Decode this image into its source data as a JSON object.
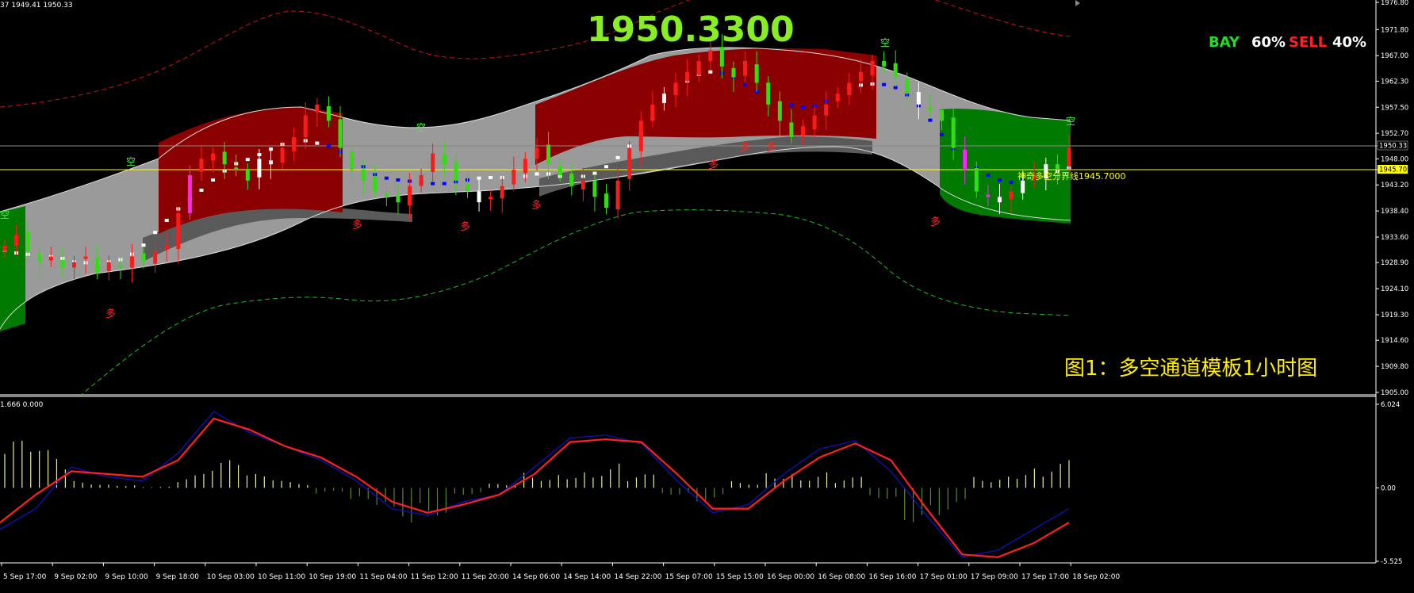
{
  "window": {
    "header_text": "37 1949.41 1950.33",
    "macd_header": "1.666 0.000"
  },
  "current_price_label": "1950.3300",
  "sentiment": {
    "buy_label": "BAY",
    "buy_pct": "60%",
    "sell_label": "SELL",
    "sell_pct": "40%"
  },
  "boundary_label": "神奇多空分界线1945.7000",
  "figure_caption": "图1：多空通道模板1小时图",
  "main_axis": {
    "ticks": [
      "1976.80",
      "1971.80",
      "1967.00",
      "1962.30",
      "1957.50",
      "1952.70",
      "1948.00",
      "1943.20",
      "1938.40",
      "1933.60",
      "1928.90",
      "1924.10",
      "1919.30",
      "1914.60",
      "1909.80",
      "1905.00"
    ],
    "current_marker": "1950.33",
    "boundary_marker": "1945.70"
  },
  "macd_axis": {
    "ticks": [
      "6.024",
      "0.00",
      "-5.525"
    ]
  },
  "time_axis": {
    "labels": [
      "5 Sep 17:00",
      "9 Sep 02:00",
      "9 Sep 10:00",
      "9 Sep 18:00",
      "10 Sep 03:00",
      "10 Sep 11:00",
      "10 Sep 19:00",
      "11 Sep 04:00",
      "11 Sep 12:00",
      "11 Sep 20:00",
      "14 Sep 06:00",
      "14 Sep 14:00",
      "14 Sep 22:00",
      "15 Sep 07:00",
      "15 Sep 15:00",
      "16 Sep 00:00",
      "16 Sep 08:00",
      "16 Sep 16:00",
      "17 Sep 01:00",
      "17 Sep 09:00",
      "17 Sep 17:00",
      "18 Sep 02:00"
    ]
  },
  "signal_marks": {
    "bull_text": "多",
    "bear_text": "空"
  },
  "colors": {
    "bg": "#000000",
    "bull_candle": "#ff1a1a",
    "bear_candle": "#33dd11",
    "ext_candle": "#ffffff",
    "magenta_candle": "#ff22ff",
    "band_red": "#8b0000",
    "band_gray": "#9a9a9a",
    "band_dark": "#5a5a5a",
    "band_green": "#007a00",
    "upper_dash": "#cc1111",
    "lower_dash": "#22bb22",
    "midline_white": "#ffffff",
    "midline_blue": "#0000ff",
    "price_text": "#88ee22",
    "caption": "#ffee00",
    "boundary_line": "#ffff00",
    "macd_signal": "#ff2020",
    "macd_main": "#1010c0",
    "hist_pos": "#eeee99",
    "hist_neg": "#558833"
  },
  "chart_data": {
    "type": "candlestick",
    "title": "",
    "ylim": [
      1905.0,
      1976.8
    ],
    "current_price": 1950.33,
    "boundary_price": 1945.7,
    "series": [
      {
        "name": "price",
        "note": "hourly candles, approximate closes",
        "values": [
          1932,
          1934,
          1931,
          1929,
          1930,
          1928,
          1929,
          1930,
          1927,
          1929,
          1928,
          1930,
          1929,
          1931,
          1932,
          1938,
          1945,
          1948,
          1949,
          1947,
          1946,
          1944,
          1948,
          1947,
          1950,
          1952,
          1956,
          1958,
          1955,
          1950,
          1946,
          1944,
          1942,
          1941,
          1940,
          1943,
          1945,
          1949,
          1947,
          1944,
          1942,
          1940,
          1941,
          1943,
          1946,
          1948,
          1950,
          1947,
          1945,
          1943,
          1944,
          1941,
          1939,
          1944,
          1950,
          1955,
          1958,
          1960,
          1962,
          1964,
          1966,
          1968,
          1965,
          1963,
          1966,
          1962,
          1958,
          1955,
          1952,
          1954,
          1956,
          1958,
          1960,
          1962,
          1964,
          1966,
          1965,
          1963,
          1960,
          1958,
          1957,
          1955,
          1950,
          1946,
          1942,
          1941,
          1940,
          1942,
          1944,
          1945,
          1947,
          1946,
          1950
        ]
      }
    ],
    "macd": {
      "ylim": [
        -5.525,
        6.024
      ],
      "main": [
        -3.0,
        -1.5,
        1.5,
        0.8,
        0.5,
        2.5,
        5.5,
        4.0,
        3.0,
        2.0,
        0.5,
        -1.5,
        -2.0,
        -1.0,
        -0.5,
        1.5,
        3.6,
        3.8,
        3.2,
        0.5,
        -1.8,
        -1.2,
        1.0,
        2.8,
        3.4,
        1.2,
        -2.0,
        -5.0,
        -4.5,
        -3.0,
        -1.5
      ],
      "signal": [
        -2.5,
        -0.5,
        1.2,
        1.0,
        0.8,
        2.0,
        5.0,
        4.2,
        3.0,
        2.2,
        0.8,
        -1.0,
        -1.8,
        -1.2,
        -0.5,
        1.0,
        3.3,
        3.5,
        3.3,
        1.0,
        -1.5,
        -1.5,
        0.5,
        2.2,
        3.2,
        2.0,
        -1.5,
        -4.8,
        -5.0,
        -4.0,
        -2.5
      ],
      "histogram": [
        3.5,
        2.8,
        0.5,
        0.3,
        0.1,
        1.0,
        2.0,
        1.0,
        0.5,
        -0.5,
        -1.5,
        -2.5,
        -2.0,
        -0.5,
        0.3,
        1.2,
        1.5,
        1.8,
        1.0,
        -0.5,
        -1.0,
        0.5,
        1.5,
        1.2,
        0.8,
        -0.8,
        -2.5,
        -2.0,
        1.0,
        1.6,
        2.0
      ]
    }
  }
}
